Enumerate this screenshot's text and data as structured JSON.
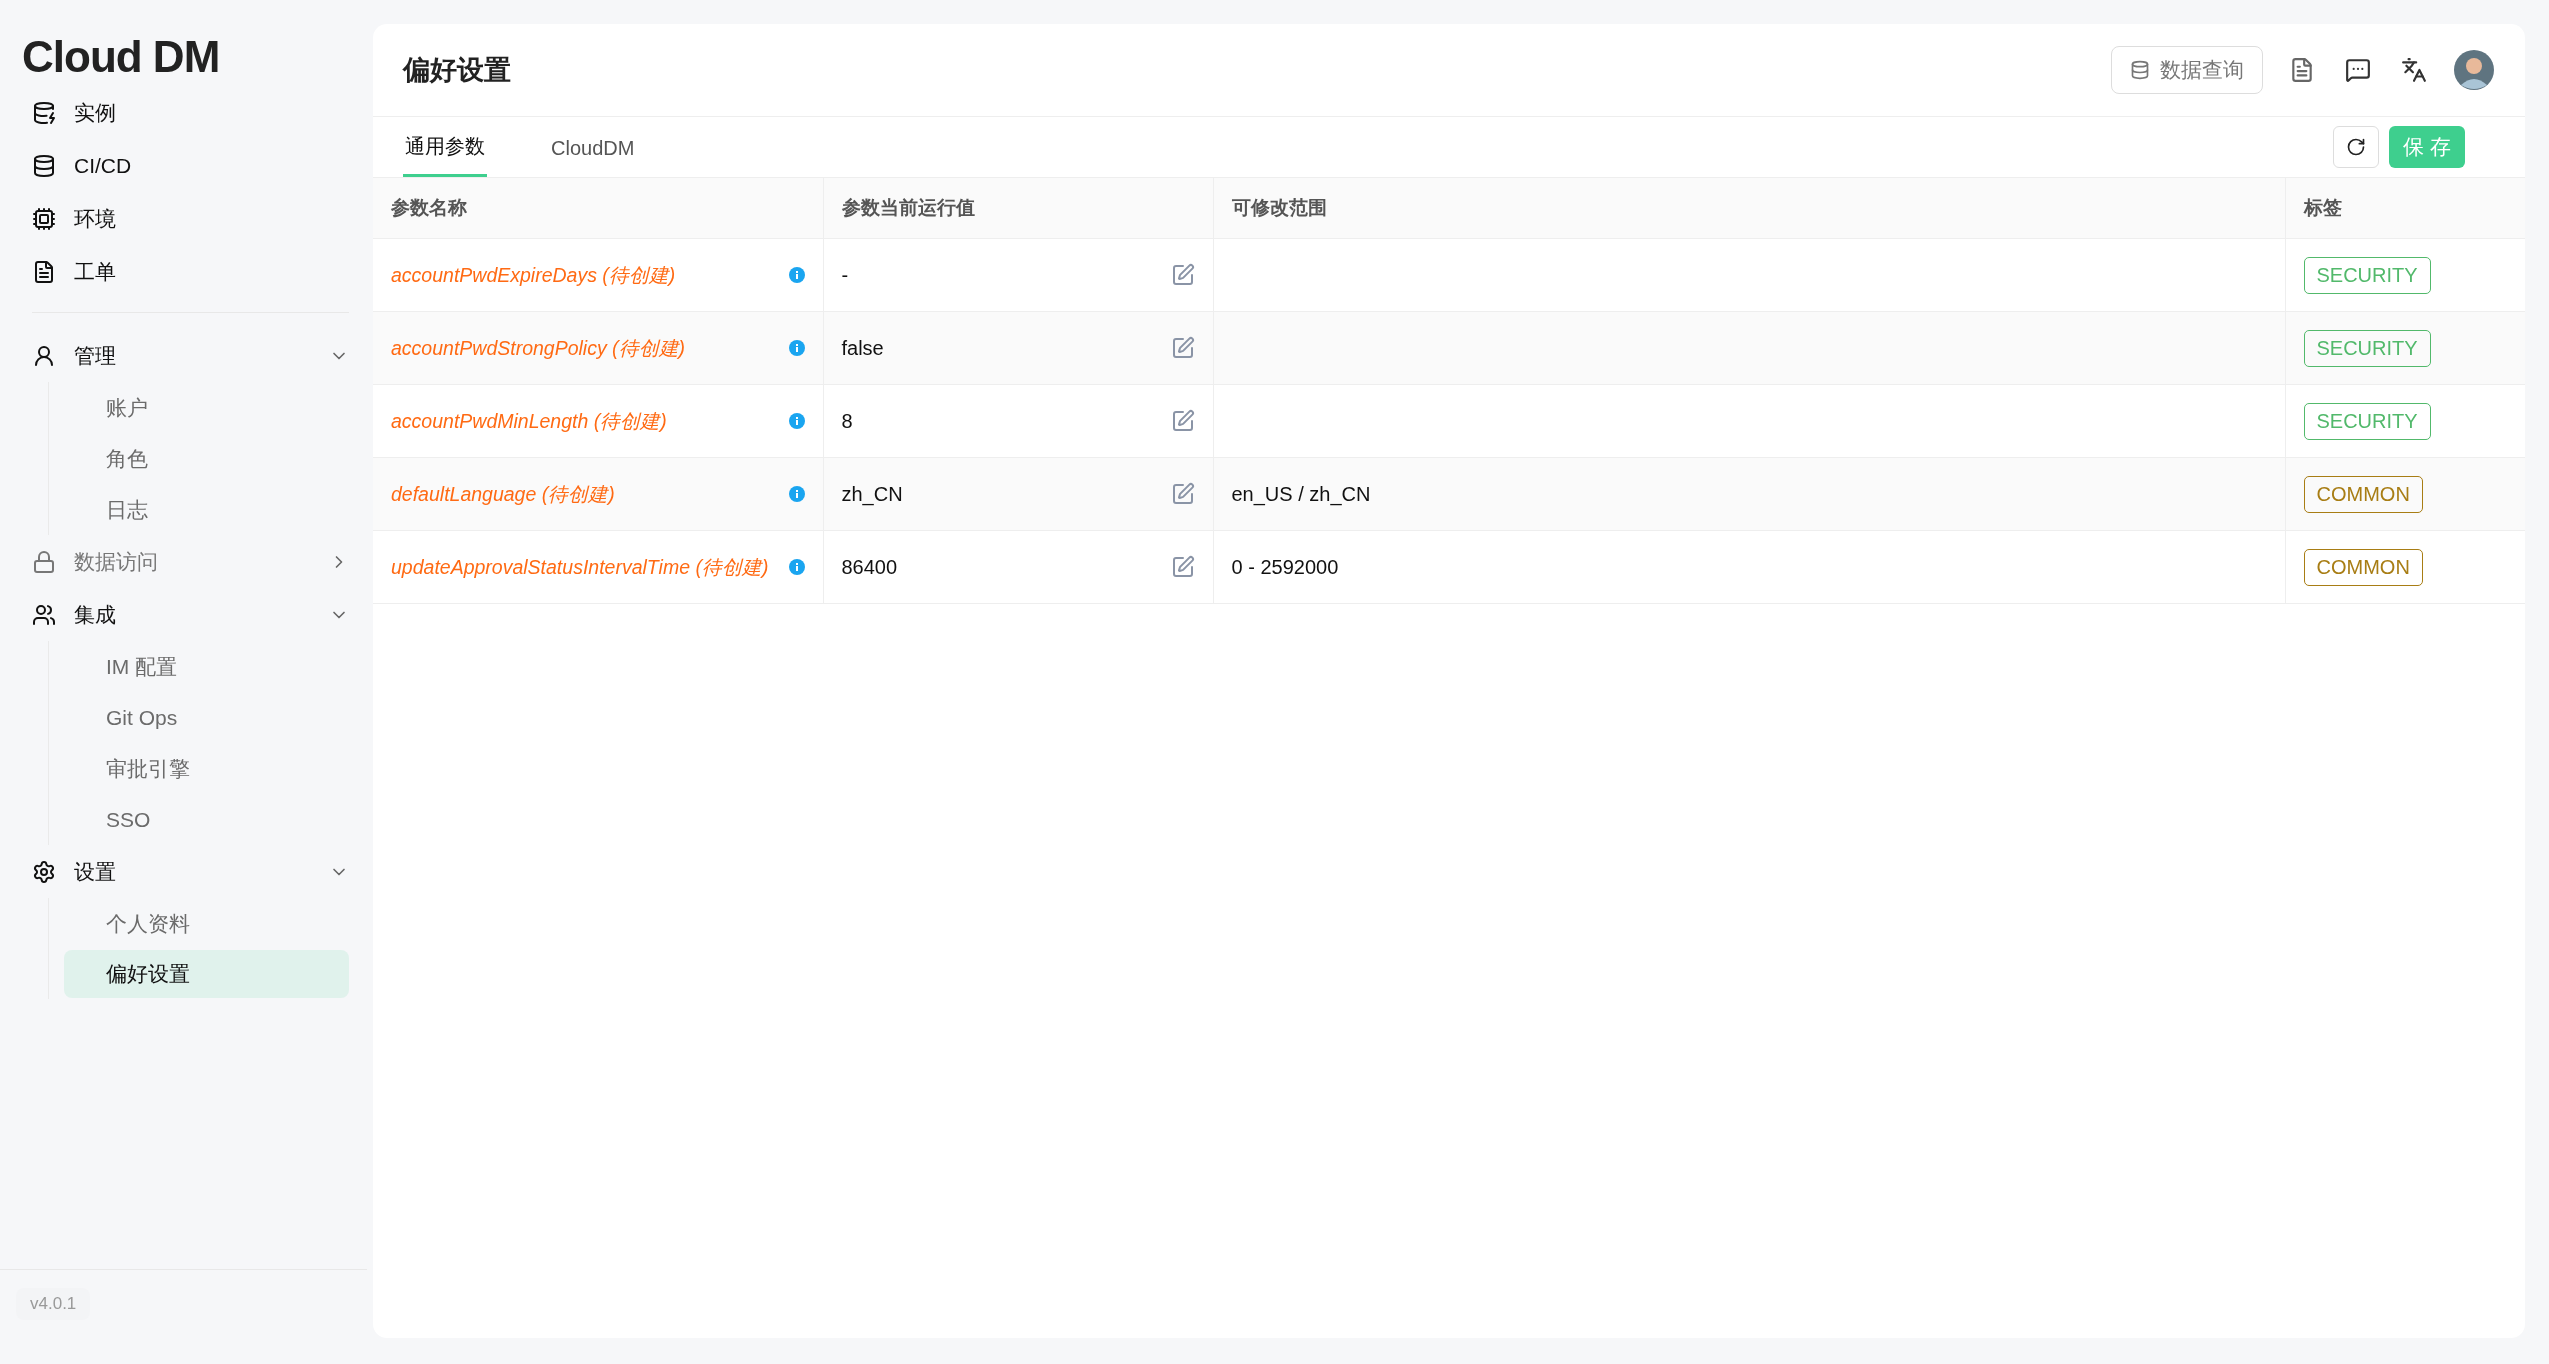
{
  "sidebar": {
    "logo": "Cloud DM",
    "items": [
      {
        "label": "实例"
      },
      {
        "label": "CI/CD"
      },
      {
        "label": "环境"
      },
      {
        "label": "工单"
      }
    ],
    "sections": [
      {
        "label": "管理",
        "expanded": true,
        "children": [
          {
            "label": "账户",
            "selected": false
          },
          {
            "label": "角色",
            "selected": false
          },
          {
            "label": "日志",
            "selected": false
          }
        ]
      },
      {
        "label": "数据访问",
        "expanded": false
      },
      {
        "label": "集成",
        "expanded": true,
        "children": [
          {
            "label": "IM 配置",
            "selected": false
          },
          {
            "label": "Git Ops",
            "selected": false
          },
          {
            "label": "审批引擎",
            "selected": false
          },
          {
            "label": "SSO",
            "selected": false
          }
        ]
      },
      {
        "label": "设置",
        "expanded": true,
        "children": [
          {
            "label": "个人资料",
            "selected": false
          },
          {
            "label": "偏好设置",
            "selected": true
          }
        ]
      }
    ],
    "version": "v4.0.1"
  },
  "header": {
    "title": "偏好设置",
    "query_button": "数据查询"
  },
  "tabs": [
    {
      "label": "通用参数",
      "selected": true
    },
    {
      "label": "CloudDM",
      "selected": false
    }
  ],
  "save_button": "保 存",
  "table": {
    "columns": [
      "参数名称",
      "参数当前运行值",
      "可修改范围",
      "标签"
    ],
    "rows": [
      {
        "name": "accountPwdExpireDays (待创建)",
        "value": "-",
        "tag": {
          "label": "SECURITY",
          "color": "#52b96b"
        }
      },
      {
        "name": "accountPwdStrongPolicy (待创建)",
        "value": "false",
        "tag": {
          "label": "SECURITY",
          "color": "#52b96b"
        }
      },
      {
        "name": "accountPwdMinLength (待创建)",
        "value": "8",
        "tag": {
          "label": "SECURITY",
          "color": "#52b96b"
        }
      },
      {
        "name": "defaultLanguage (待创建)",
        "value": "zh_CN",
        "range": "en_US / zh_CN",
        "tag": {
          "label": "COMMON",
          "color": "#a87d14"
        }
      },
      {
        "name": "updateApprovalStatusIntervalTime (待创建)",
        "value": "86400",
        "range": "0 - 2592000",
        "tag": {
          "label": "COMMON",
          "color": "#a87d14"
        }
      }
    ]
  }
}
